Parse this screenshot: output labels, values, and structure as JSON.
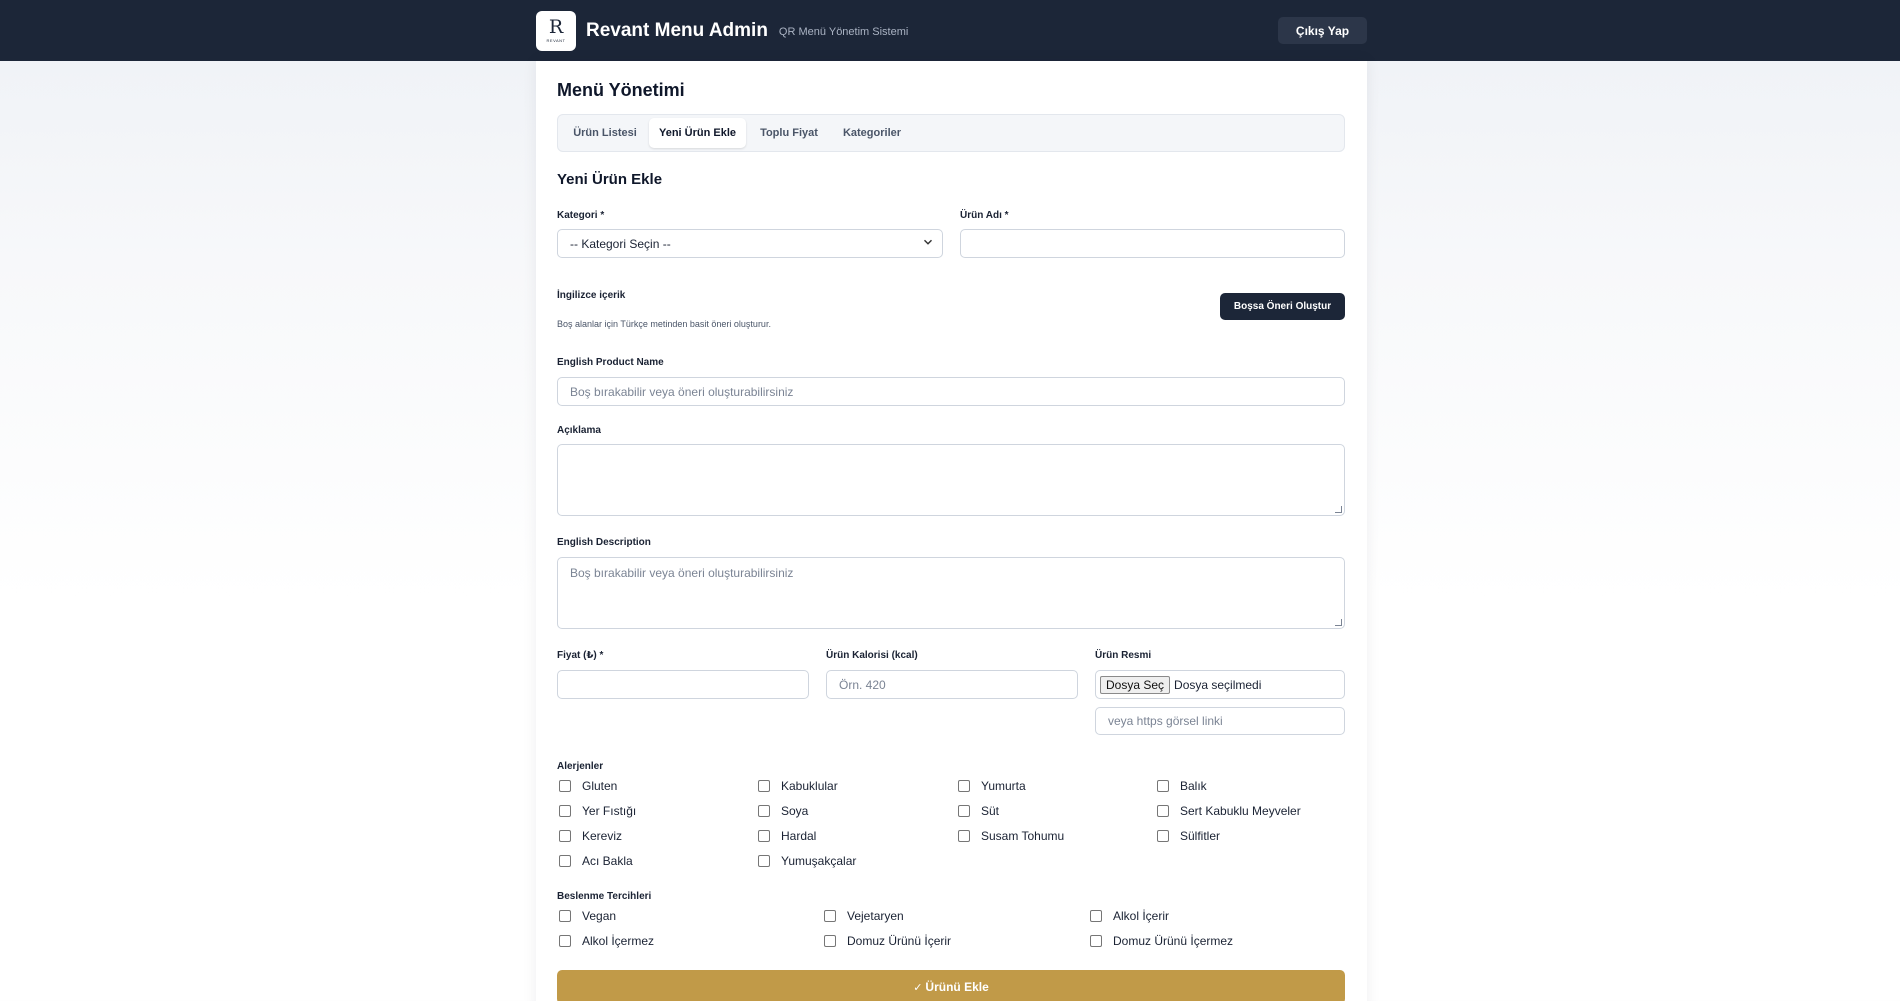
{
  "header": {
    "logo_letter": "R",
    "logo_sub": "REVANT",
    "title": "Revant Menu Admin",
    "subtitle": "QR Menü Yönetim Sistemi",
    "logout_label": "Çıkış Yap"
  },
  "page": {
    "title": "Menü Yönetimi",
    "tabs": [
      {
        "label": "Ürün Listesi",
        "active": false
      },
      {
        "label": "Yeni Ürün Ekle",
        "active": true
      },
      {
        "label": "Toplu Fiyat",
        "active": false
      },
      {
        "label": "Kategoriler",
        "active": false
      }
    ]
  },
  "form": {
    "title": "Yeni Ürün Ekle",
    "category": {
      "label": "Kategori *",
      "selected": "-- Kategori Seçin --"
    },
    "name": {
      "label": "Ürün Adı *",
      "value": ""
    },
    "english": {
      "title": "İngilizce içerik",
      "hint": "Boş alanlar için Türkçe metinden basit öneri oluşturur.",
      "suggest_button": "Boşsa Öneri Oluştur"
    },
    "english_name": {
      "label": "English Product Name",
      "placeholder": "Boş bırakabilir veya öneri oluşturabilirsiniz"
    },
    "description": {
      "label": "Açıklama",
      "value": ""
    },
    "english_description": {
      "label": "English Description",
      "placeholder": "Boş bırakabilir veya öneri oluşturabilirsiniz"
    },
    "price": {
      "label": "Fiyat (₺) *",
      "value": ""
    },
    "calories": {
      "label": "Ürün Kalorisi (kcal)",
      "placeholder": "Örn. 420"
    },
    "image": {
      "label": "Ürün Resmi",
      "file_button": "Dosya Seç",
      "file_status": "Dosya seçilmedi",
      "url_placeholder": "veya https görsel linki"
    },
    "allergens": {
      "label": "Alerjenler",
      "items": [
        "Gluten",
        "Kabuklular",
        "Yumurta",
        "Balık",
        "Yer Fıstığı",
        "Soya",
        "Süt",
        "Sert Kabuklu Meyveler",
        "Kereviz",
        "Hardal",
        "Susam Tohumu",
        "Sülfitler",
        "Acı Bakla",
        "Yumuşakçalar"
      ]
    },
    "diet": {
      "label": "Beslenme Tercihleri",
      "items": [
        "Vegan",
        "Vejetaryen",
        "Alkol İçerir",
        "Alkol İçermez",
        "Domuz Ürünü İçerir",
        "Domuz Ürünü İçermez"
      ]
    },
    "submit_label": "Ürünü Ekle",
    "submit_icon": "✓"
  },
  "colors": {
    "header_bg": "#1c2638",
    "accent_gold": "#c19a48",
    "primary_dark": "#1c2638"
  }
}
